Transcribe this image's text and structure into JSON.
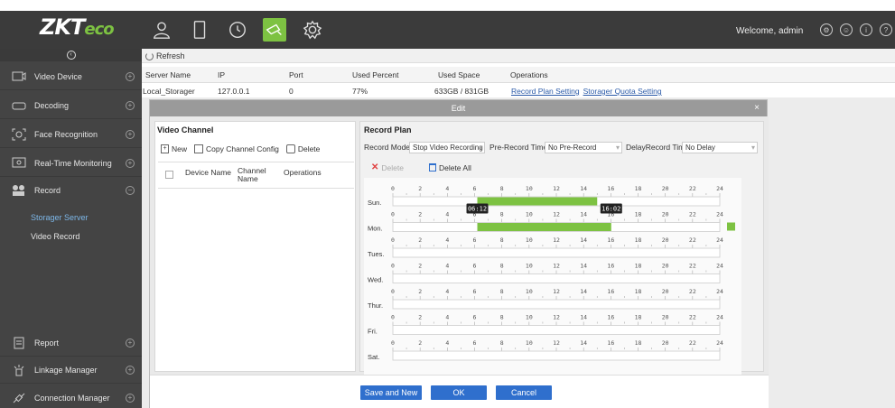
{
  "brand": {
    "logo_main": "ZKT",
    "logo_eco": "eco"
  },
  "header": {
    "welcome": "Welcome, admin"
  },
  "sidebar": {
    "items": [
      {
        "label": "Video Device"
      },
      {
        "label": "Decoding"
      },
      {
        "label": "Face Recognition"
      },
      {
        "label": "Real-Time Monitoring"
      },
      {
        "label": "Record"
      },
      {
        "label": "Report"
      },
      {
        "label": "Linkage Manager"
      },
      {
        "label": "Connection Manager"
      }
    ],
    "record_sub": [
      "Storager Server",
      "Video Record"
    ]
  },
  "toolbar": {
    "refresh": "Refresh"
  },
  "table": {
    "columns": [
      "Server Name",
      "IP",
      "Port",
      "Used Percent",
      "Used Space",
      "Operations"
    ],
    "row": {
      "server_name": "Local_Storager",
      "ip": "127.0.0.1",
      "port": "0",
      "used_percent": "77%",
      "used_space": "633GB / 831GB",
      "op1": "Record Plan Setting",
      "op2": "Storager Quota Setting"
    }
  },
  "dialog": {
    "title": "Edit",
    "video_channel": {
      "title": "Video Channel",
      "new": "New",
      "copy": "Copy Channel Config",
      "delete": "Delete",
      "columns": [
        "Device Name",
        "Channel Name",
        "Operations"
      ]
    },
    "record_plan": {
      "title": "Record Plan",
      "model_label": "Record Model",
      "model_value": "Stop Video Recording",
      "prerecord_label": "Pre-Record Time",
      "prerecord_value": "No Pre-Record",
      "delay_label": "DelayRecord Time",
      "delay_value": "No Delay",
      "delete": "Delete",
      "delete_all": "Delete All",
      "days": [
        "Sun.",
        "Mon.",
        "Tues.",
        "Wed.",
        "Thur.",
        "Fri.",
        "Sat."
      ],
      "hour_ticks": [
        "0",
        "2",
        "4",
        "6",
        "8",
        "10",
        "12",
        "14",
        "16",
        "18",
        "20",
        "22",
        "24"
      ],
      "ranges": [
        {
          "day_index": 0,
          "start_hour": 6.2,
          "end_hour": 15.0
        },
        {
          "day_index": 1,
          "start_hour": 6.2,
          "end_hour": 16.03
        }
      ],
      "tooltip_start": "06:12",
      "tooltip_end": "16:02",
      "bar_color": "#7dc242"
    },
    "buttons": {
      "save_new": "Save and New",
      "ok": "OK",
      "cancel": "Cancel"
    }
  }
}
